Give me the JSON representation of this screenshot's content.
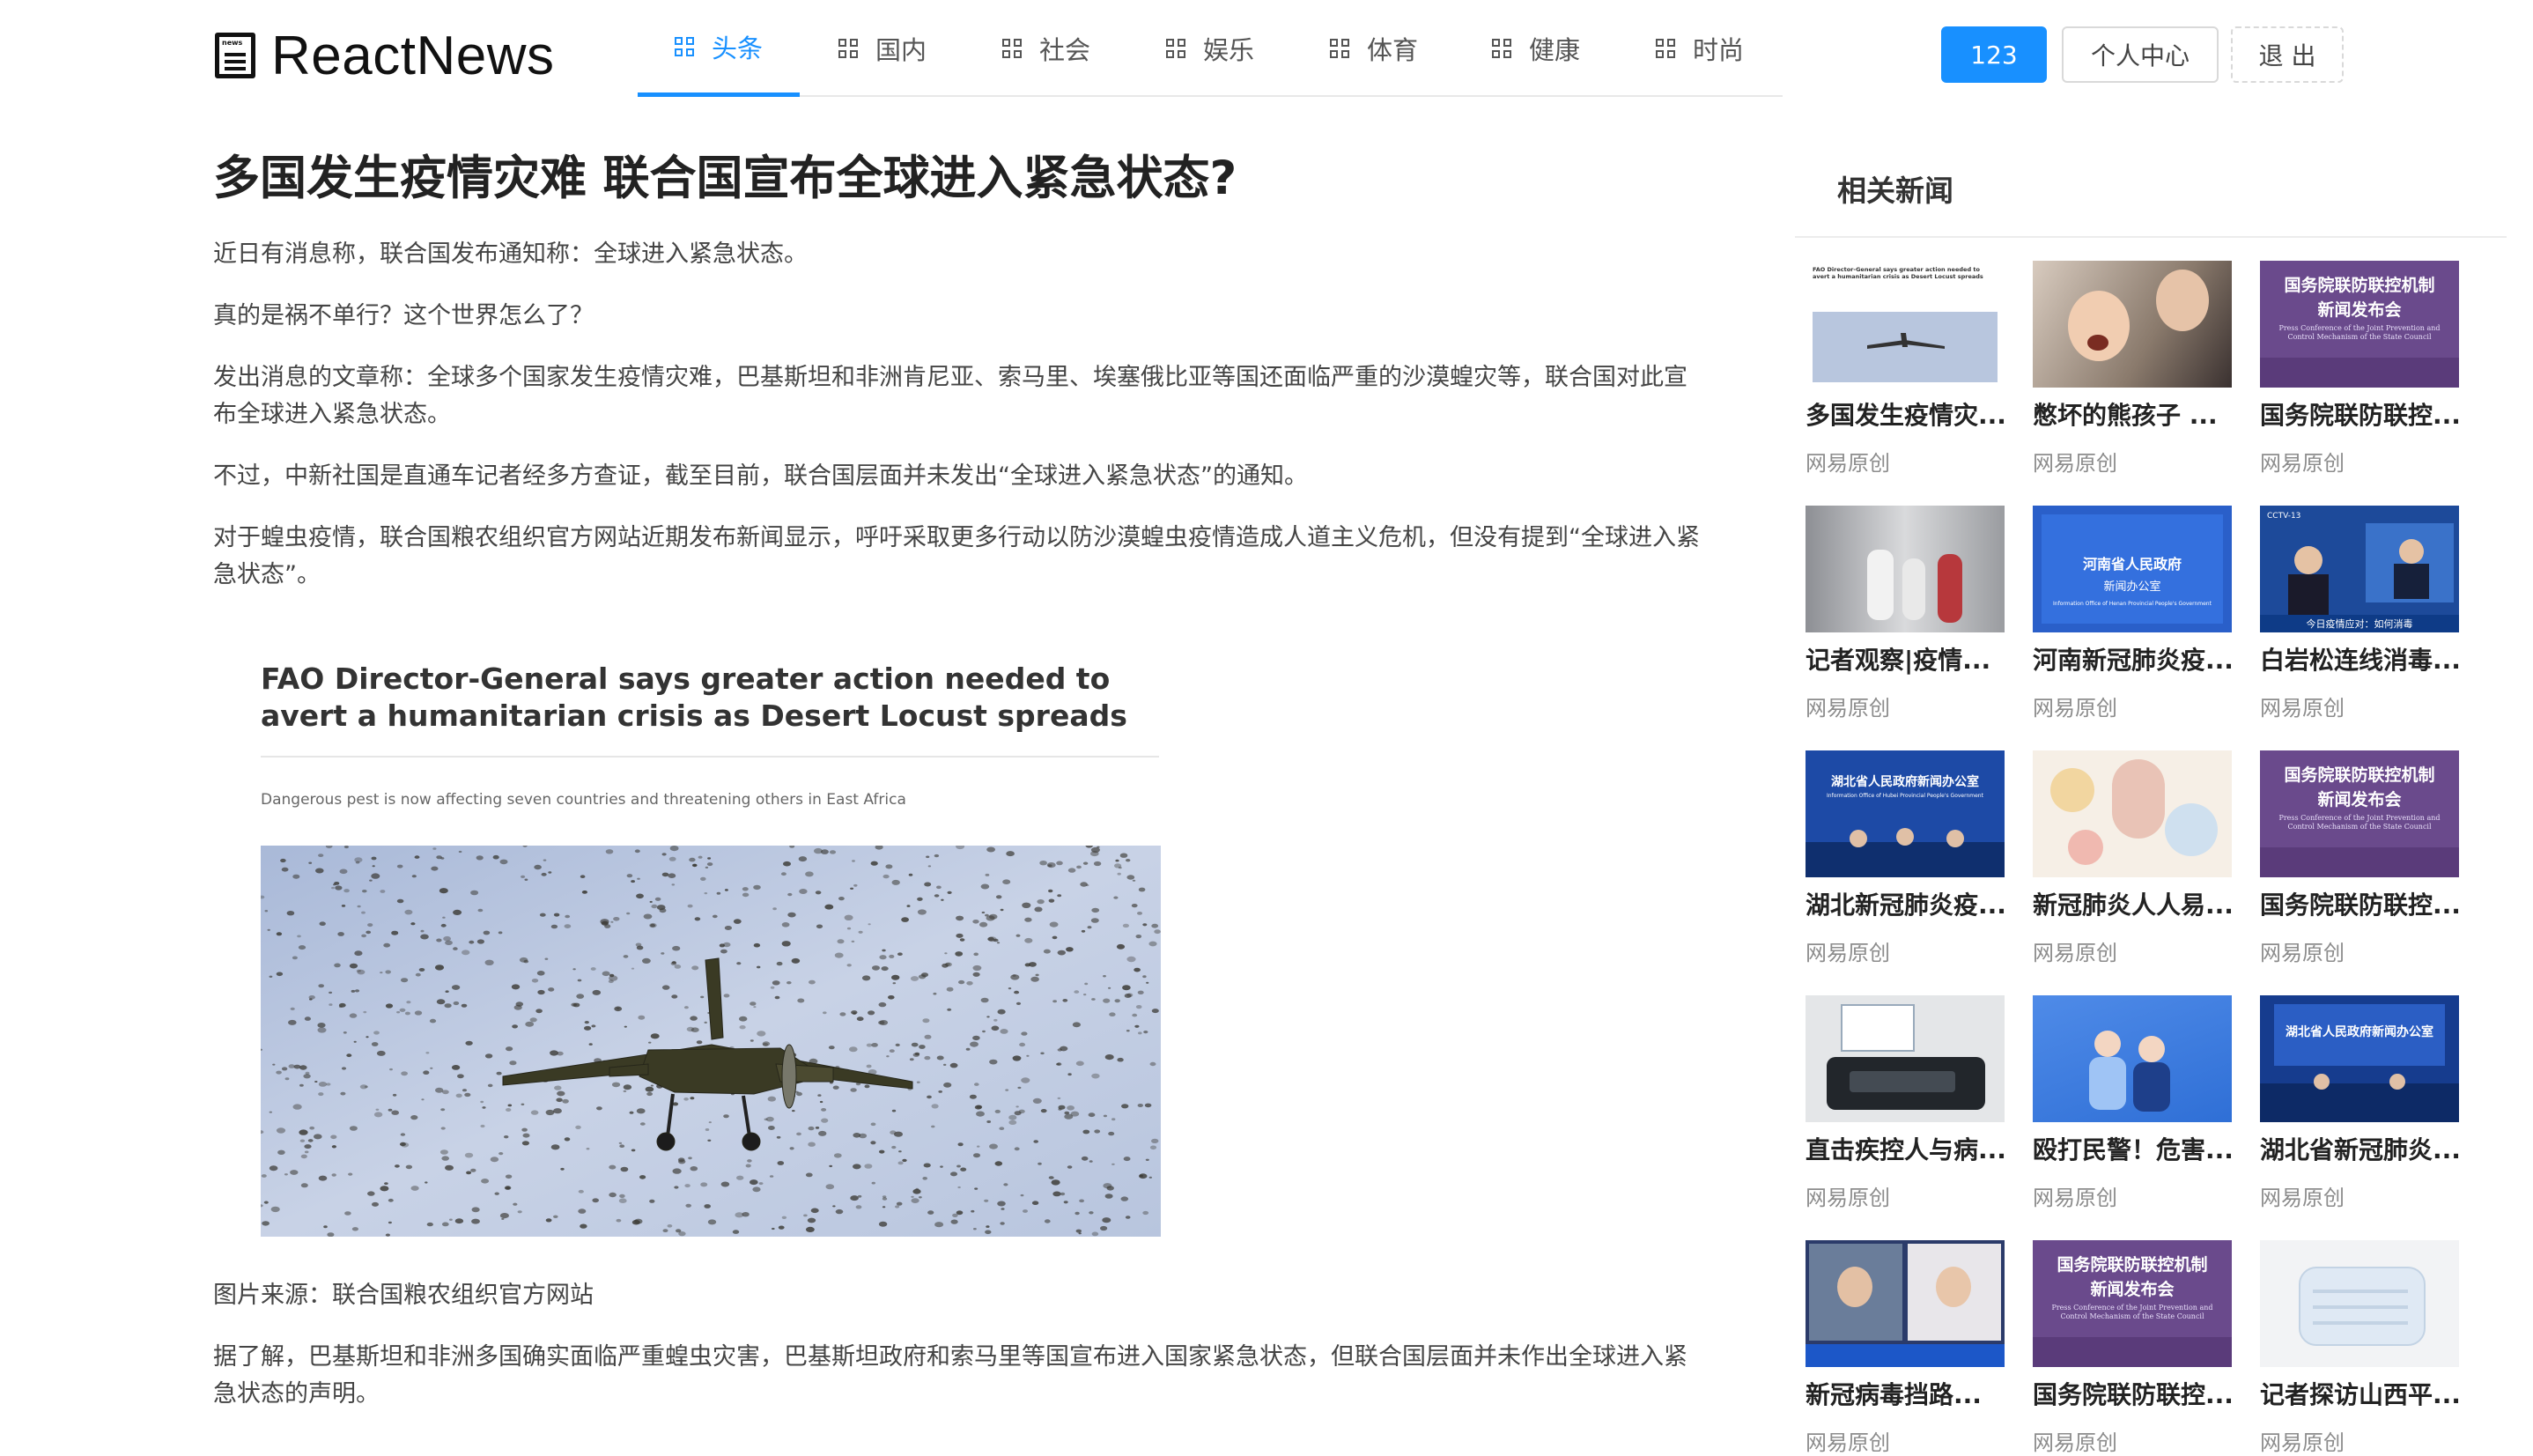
{
  "brand": {
    "name": "ReactNews",
    "icon_tag": "news"
  },
  "nav": [
    {
      "label": "头条"
    },
    {
      "label": "国内"
    },
    {
      "label": "社会"
    },
    {
      "label": "娱乐"
    },
    {
      "label": "体育"
    },
    {
      "label": "健康"
    },
    {
      "label": "时尚"
    }
  ],
  "user": {
    "name": "123",
    "center_label": "个人中心",
    "logout_label": "退 出"
  },
  "article": {
    "title": "多国发生疫情灾难 联合国宣布全球进入紧急状态?",
    "paragraphs": [
      "近日有消息称，联合国发布通知称：全球进入紧急状态。",
      "真的是祸不单行？这个世界怎么了？",
      "发出消息的文章称：全球多个国家发生疫情灾难，巴基斯坦和非洲肯尼亚、索马里、埃塞俄比亚等国还面临严重的沙漠蝗灾等，联合国对此宣布全球进入紧急状态。",
      "不过，中新社国是直通车记者经多方查证，截至目前，联合国层面并未发出“全球进入紧急状态”的通知。",
      "对于蝗虫疫情，联合国粮农组织官方网站近期发布新闻显示，呼吁采取更多行动以防沙漠蝗虫疫情造成人道主义危机，但没有提到“全球进入紧急状态”。"
    ],
    "figure": {
      "headline": "FAO Director-General says greater action needed to avert a humanitarian crisis as Desert Locust spreads",
      "subhead": "Dangerous pest is now affecting seven countries and threatening others in East Africa"
    },
    "caption": "图片来源：联合国粮农组织官方网站",
    "paragraph_after": "据了解，巴基斯坦和非洲多国确实面临严重蝗虫灾害，巴基斯坦政府和索马里等国宣布进入国家紧急状态，但联合国层面并未作出全球进入紧急状态的声明。"
  },
  "sidebar": {
    "title": "相关新闻",
    "cards": [
      {
        "title": "多国发生疫情灾...",
        "source": "网易原创",
        "thumb": "fao-plane"
      },
      {
        "title": "憋坏的熊孩子 ...",
        "source": "网易原创",
        "thumb": "kid"
      },
      {
        "title": "国务院联防联控...",
        "source": "网易原创",
        "thumb": "purple-conference"
      },
      {
        "title": "记者观察|疫情...",
        "source": "网易原创",
        "thumb": "hospital-corridor"
      },
      {
        "title": "河南新冠肺炎疫...",
        "source": "网易原创",
        "thumb": "henan-press"
      },
      {
        "title": "白岩松连线消毒...",
        "source": "网易原创",
        "thumb": "cctv-studio"
      },
      {
        "title": "湖北新冠肺炎疫...",
        "source": "网易原创",
        "thumb": "hubei-press"
      },
      {
        "title": "新冠肺炎人人易...",
        "source": "网易原创",
        "thumb": "illustration"
      },
      {
        "title": "国务院联防联控...",
        "source": "网易原创",
        "thumb": "purple-conference"
      },
      {
        "title": "直击疾控人与病...",
        "source": "网易原创",
        "thumb": "lab-device"
      },
      {
        "title": "殴打民警！危害...",
        "source": "网易原创",
        "thumb": "police-illustration"
      },
      {
        "title": "湖北省新冠肺炎...",
        "source": "网易原创",
        "thumb": "hubei-stage"
      },
      {
        "title": "新冠病毒挡路...",
        "source": "网易原创",
        "thumb": "video-call"
      },
      {
        "title": "国务院联防联控...",
        "source": "网易原创",
        "thumb": "purple-conference"
      },
      {
        "title": "记者探访山西平...",
        "source": "网易原创",
        "thumb": "mask"
      }
    ],
    "thumb_text": {
      "conference_title": "国务院联防联控机制",
      "conference_sub": "新闻发布会",
      "conference_en": "Press Conference of the Joint Prevention and Control Mechanism of the State Council",
      "henan_1": "河南省人民政府",
      "henan_2": "新闻办公室",
      "henan_en": "Information Office of Henan Provincial People's Government",
      "hubei_1": "湖北省人民政府新闻办公室",
      "hubei_en": "Information Office of Hubei Provincial People's Government",
      "cctv": "CCTV-13",
      "cctv_banner": "今日疫情应对：如何消毒",
      "fao_headline": "FAO Director-General says greater action needed to avert a humanitarian crisis as Desert Locust spreads"
    }
  }
}
